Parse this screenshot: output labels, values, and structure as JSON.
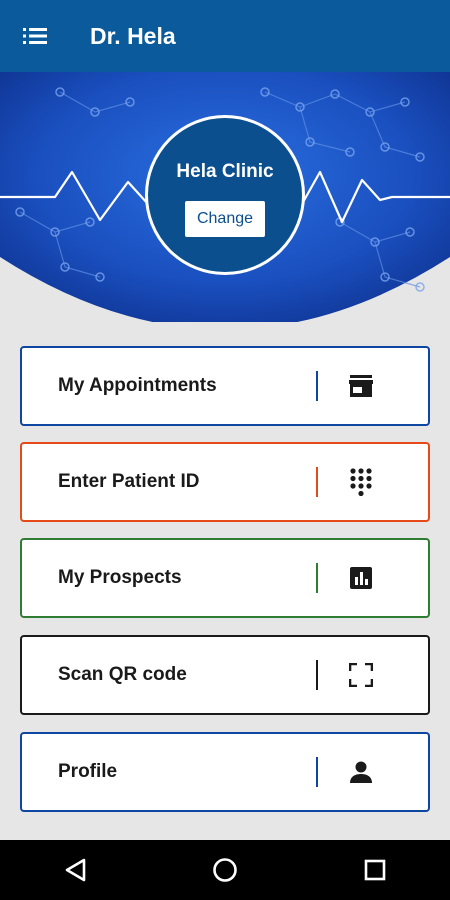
{
  "appbar": {
    "title": "Dr. Hela",
    "menu_icon": "menu-list-icon"
  },
  "clinic": {
    "name": "Hela Clinic",
    "change_label": "Change"
  },
  "menu": [
    {
      "label": "My Appointments",
      "icon": "store-icon",
      "color": "#0d47a1"
    },
    {
      "label": "Enter Patient ID",
      "icon": "dialpad-icon",
      "color": "#e64a19"
    },
    {
      "label": "My Prospects",
      "icon": "bar-chart-icon",
      "color": "#2e7d32"
    },
    {
      "label": "Scan QR code",
      "icon": "scan-frame-icon",
      "color": "#1a1a1a"
    },
    {
      "label": "Profile",
      "icon": "person-icon",
      "color": "#0d47a1"
    }
  ],
  "navbar": {
    "back_icon": "back-icon",
    "home_icon": "home-icon",
    "recents_icon": "recents-icon"
  },
  "colors": {
    "appbar": "#0a5a9c",
    "hero": "#1a56c9",
    "background": "#e6e6e6"
  }
}
